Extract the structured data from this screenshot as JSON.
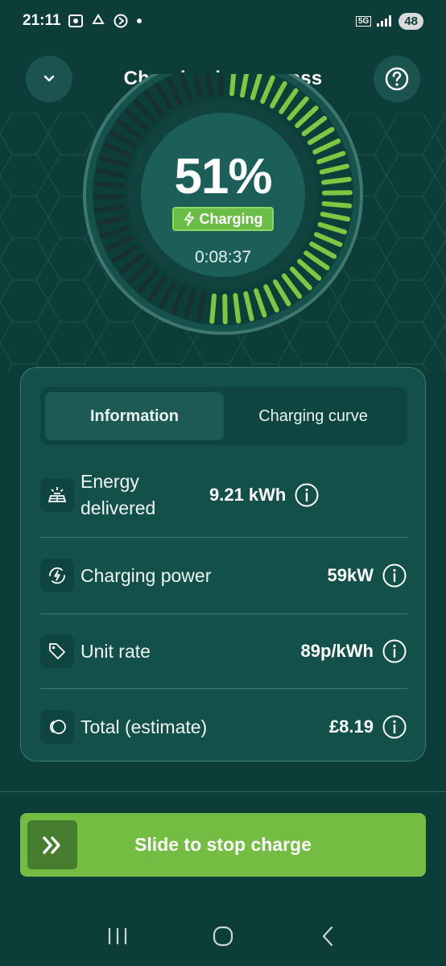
{
  "status_bar": {
    "time": "21:11",
    "battery": "48",
    "network": "5G"
  },
  "header": {
    "title": "Charging in progress",
    "collapse_icon": "chevron-down-icon",
    "help_icon": "question-circle-icon"
  },
  "gauge": {
    "percent_text": "51%",
    "percent_value": 51,
    "status_label": "Charging",
    "elapsed": "0:08:37",
    "colors": {
      "filled": "#7cc842",
      "empty": "#17312e",
      "ring": "#3f7770"
    }
  },
  "tabs": [
    {
      "label": "Information",
      "active": true
    },
    {
      "label": "Charging curve",
      "active": false
    }
  ],
  "rows": [
    {
      "label": "Energy delivered",
      "value": "9.21 kWh",
      "icon": "solar-panel-icon"
    },
    {
      "label": "Charging power",
      "value": "59kW",
      "icon": "power-bolt-icon"
    },
    {
      "label": "Unit rate",
      "value": "89p/kWh",
      "icon": "price-tag-icon"
    },
    {
      "label": "Total (estimate)",
      "value": "£8.19",
      "icon": "coins-icon"
    }
  ],
  "slider": {
    "label": "Slide to stop charge",
    "icon": "double-chevron-right-icon",
    "color": "#74bd43"
  },
  "colors": {
    "background": "#0d3d38",
    "accent": "#6abd45"
  }
}
